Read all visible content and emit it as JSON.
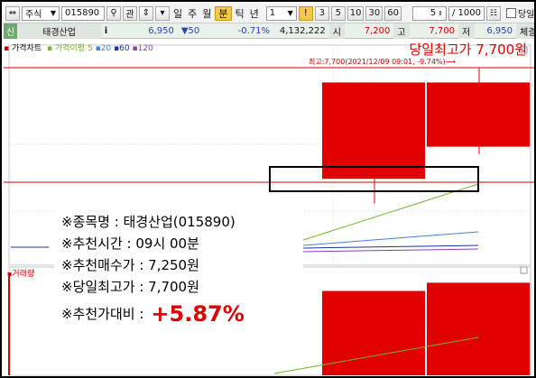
{
  "toolbar": {
    "market": "주식",
    "code": "015890",
    "search_btn": "관",
    "periods": [
      "일",
      "주",
      "월",
      "분",
      "틱",
      "년"
    ],
    "active_period": "분",
    "minute_value": "1",
    "warn_icon": "!",
    "intervals": [
      "3",
      "5",
      "10",
      "30",
      "60"
    ],
    "count_value": "5",
    "max_count": "/ 1000",
    "same_day_label": "당일"
  },
  "quote": {
    "badge": "신",
    "name": "태경산업",
    "info_icon": "i",
    "price": "6,950",
    "change": "▼50",
    "change_pct": "-0.71%",
    "volume": "4,132,222",
    "open_label": "시",
    "open": "7,200",
    "high_label": "고",
    "high": "7,700",
    "low_label": "저",
    "low": "6,950",
    "trade_label": "체결"
  },
  "chart": {
    "legend_main": "가격차트",
    "legend_ma": "가격이평",
    "legend_periods": [
      "5",
      "20",
      "60",
      "120"
    ],
    "volume_label": "거래량",
    "highlight_title": "당일최고가 7,700원",
    "highlight_note": "최고:7,700(2021/12/09 09:01, -9.74%)⟶",
    "colors": {
      "candle": "#e00000",
      "ma5": "#75b52d",
      "ma20": "#3f7fe0",
      "ma60": "#1f2fa8",
      "ma120": "#8a3fb0"
    },
    "candles": [
      {
        "open": 7250,
        "close": 7640,
        "high": 7640,
        "low": 7150
      },
      {
        "open": 7380,
        "close": 7640,
        "high": 7700,
        "low": 7350
      }
    ],
    "volumes": [
      0.82,
      0.9
    ]
  },
  "info": {
    "name_line": "※종목명 : 태경산업(015890)",
    "time_line": "※추천시간 : 09시 00분",
    "buy_line": "※추천매수가 : 7,250원",
    "high_line": "※당일최고가 : 7,700원",
    "gain_label": "※추천가대비 :",
    "gain_value": "+5.87%"
  }
}
